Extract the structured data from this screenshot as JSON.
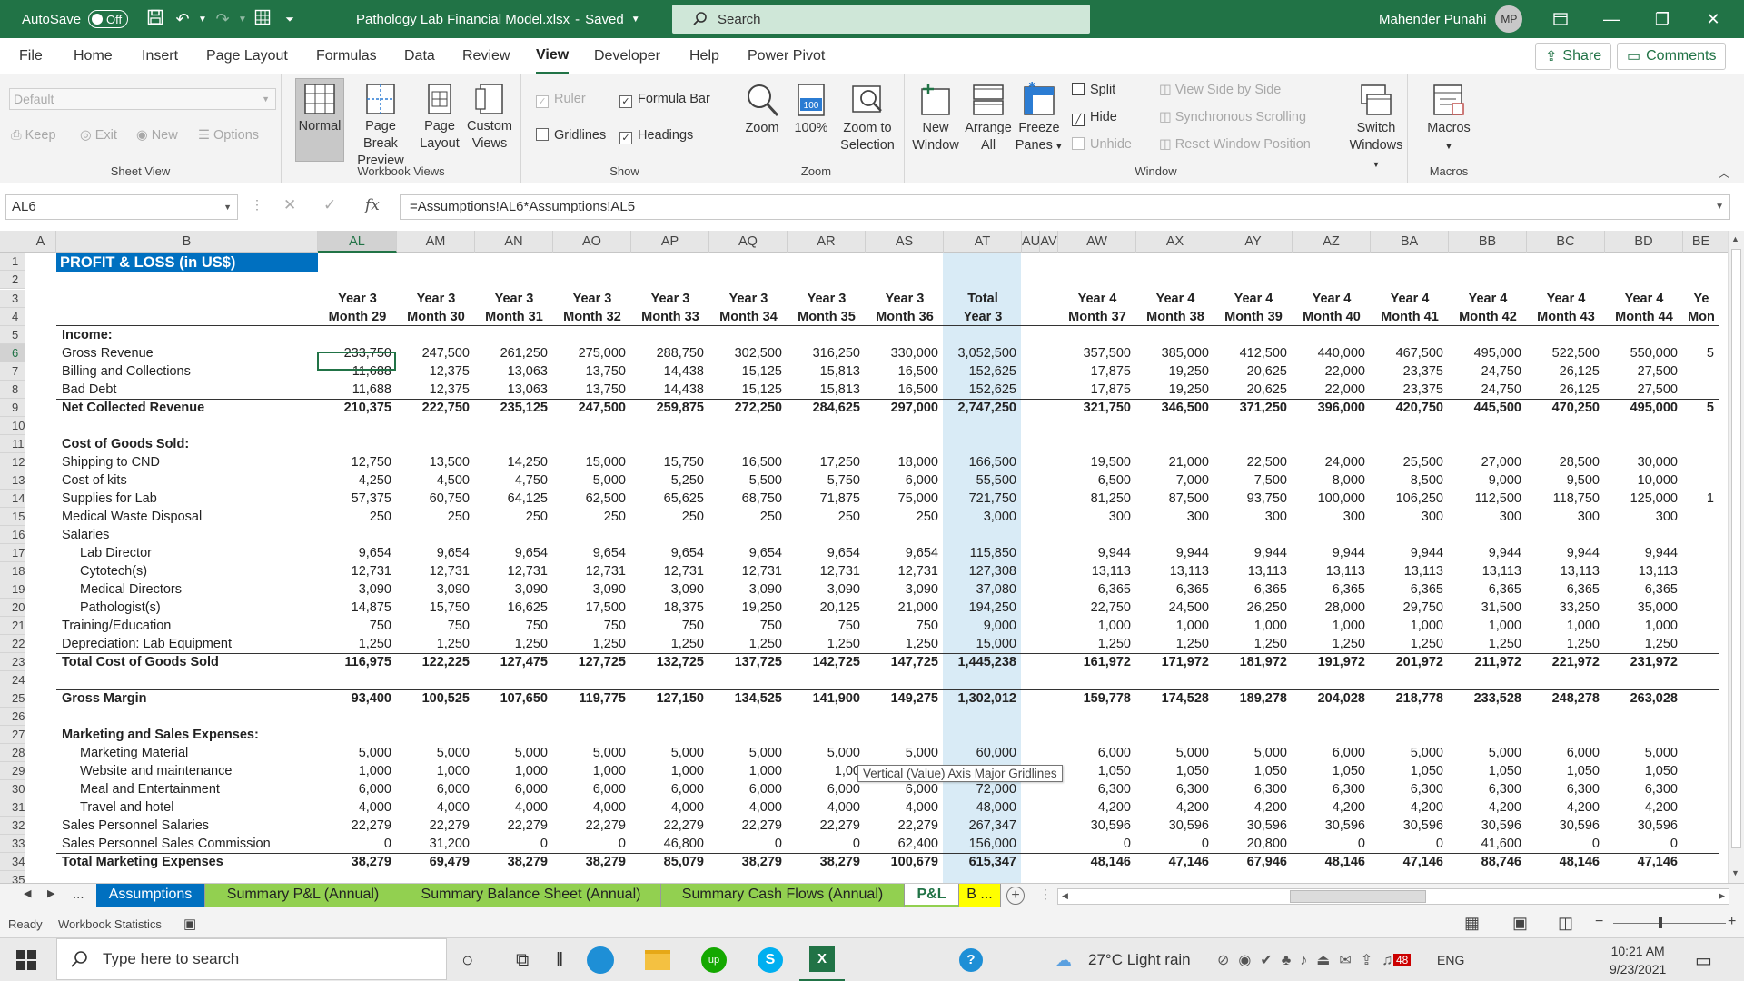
{
  "titlebar": {
    "autosave_label": "AutoSave",
    "autosave_state": "Off",
    "filename": "Pathology Lab Financial Model.xlsx",
    "saved": "Saved",
    "search_placeholder": "Search",
    "user": "Mahender Punahi",
    "initials": "MP"
  },
  "menu": {
    "items": [
      "File",
      "Home",
      "Insert",
      "Page Layout",
      "Formulas",
      "Data",
      "Review",
      "View",
      "Developer",
      "Help",
      "Power Pivot"
    ],
    "active": "View",
    "share": "Share",
    "comments": "Comments"
  },
  "ribbon": {
    "sheet_view": {
      "name": "Sheet View",
      "dropdown": "Default",
      "keep": "Keep",
      "exit": "Exit",
      "new": "New",
      "options": "Options"
    },
    "workbook_views": {
      "name": "Workbook Views",
      "normal": "Normal",
      "page_break_1": "Page Break",
      "page_break_2": "Preview",
      "page_layout_1": "Page",
      "page_layout_2": "Layout",
      "custom_1": "Custom",
      "custom_2": "Views"
    },
    "show": {
      "name": "Show",
      "ruler": "Ruler",
      "formula_bar": "Formula Bar",
      "gridlines": "Gridlines",
      "headings": "Headings"
    },
    "zoom": {
      "name": "Zoom",
      "zoom": "Zoom",
      "hundred": "100%",
      "icon_100": "100",
      "zoom_sel_1": "Zoom to",
      "zoom_sel_2": "Selection"
    },
    "window": {
      "name": "Window",
      "new_1": "New",
      "new_2": "Window",
      "arrange_1": "Arrange",
      "arrange_2": "All",
      "freeze_1": "Freeze",
      "freeze_2": "Panes",
      "split": "Split",
      "hide": "Hide",
      "unhide": "Unhide",
      "side_by_side": "View Side by Side",
      "sync_scroll": "Synchronous Scrolling",
      "reset_pos": "Reset Window Position",
      "switch_1": "Switch",
      "switch_2": "Windows"
    },
    "macros": {
      "name": "Macros",
      "macros": "Macros"
    }
  },
  "formula": {
    "namebox": "AL6",
    "cancel": "✕",
    "enter": "✓",
    "fx": "fx",
    "text": "=Assumptions!AL6*Assumptions!AL5"
  },
  "columns": [
    "A",
    "B",
    "AL",
    "AM",
    "AN",
    "AO",
    "AP",
    "AQ",
    "AR",
    "AS",
    "AT",
    "AU",
    "AV",
    "AW",
    "AX",
    "AY",
    "AZ",
    "BA",
    "BB",
    "BC",
    "BD",
    "BE"
  ],
  "sheet": {
    "title": "PROFIT & LOSS (in US$)",
    "header_year": [
      "Year 3",
      "Year 3",
      "Year 3",
      "Year 3",
      "Year 3",
      "Year 3",
      "Year 3",
      "Year 3",
      "Total",
      "Year 4",
      "Year 4",
      "Year 4",
      "Year 4",
      "Year 4",
      "Year 4",
      "Year 4",
      "Year 4",
      "Ye"
    ],
    "header_month": [
      "Month 29",
      "Month 30",
      "Month 31",
      "Month 32",
      "Month 33",
      "Month 34",
      "Month 35",
      "Month 36",
      "Year 3",
      "Month 37",
      "Month 38",
      "Month 39",
      "Month 40",
      "Month 41",
      "Month 42",
      "Month 43",
      "Month 44",
      "Mon"
    ],
    "rows": [
      {
        "r": 1,
        "label": ""
      },
      {
        "r": 2,
        "label": ""
      },
      {
        "r": 3,
        "label": ""
      },
      {
        "r": 4,
        "label": ""
      },
      {
        "r": 5,
        "label": "Income:",
        "bold": true
      },
      {
        "r": 6,
        "label": "Gross Revenue",
        "v": [
          "233,750",
          "247,500",
          "261,250",
          "275,000",
          "288,750",
          "302,500",
          "316,250",
          "330,000",
          "3,052,500",
          "357,500",
          "385,000",
          "412,500",
          "440,000",
          "467,500",
          "495,000",
          "522,500",
          "550,000",
          "5"
        ]
      },
      {
        "r": 7,
        "label": "Billing and Collections",
        "v": [
          "11,688",
          "12,375",
          "13,063",
          "13,750",
          "14,438",
          "15,125",
          "15,813",
          "16,500",
          "152,625",
          "17,875",
          "19,250",
          "20,625",
          "22,000",
          "23,375",
          "24,750",
          "26,125",
          "27,500",
          ""
        ]
      },
      {
        "r": 8,
        "label": "Bad Debt",
        "v": [
          "11,688",
          "12,375",
          "13,063",
          "13,750",
          "14,438",
          "15,125",
          "15,813",
          "16,500",
          "152,625",
          "17,875",
          "19,250",
          "20,625",
          "22,000",
          "23,375",
          "24,750",
          "26,125",
          "27,500",
          ""
        ]
      },
      {
        "r": 9,
        "label": "Net Collected Revenue",
        "bold": true,
        "v": [
          "210,375",
          "222,750",
          "235,125",
          "247,500",
          "259,875",
          "272,250",
          "284,625",
          "297,000",
          "2,747,250",
          "321,750",
          "346,500",
          "371,250",
          "396,000",
          "420,750",
          "445,500",
          "470,250",
          "495,000",
          "5"
        ]
      },
      {
        "r": 10,
        "label": ""
      },
      {
        "r": 11,
        "label": "Cost of Goods Sold:",
        "bold": true
      },
      {
        "r": 12,
        "label": "Shipping to CND",
        "v": [
          "12,750",
          "13,500",
          "14,250",
          "15,000",
          "15,750",
          "16,500",
          "17,250",
          "18,000",
          "166,500",
          "19,500",
          "21,000",
          "22,500",
          "24,000",
          "25,500",
          "27,000",
          "28,500",
          "30,000",
          ""
        ]
      },
      {
        "r": 13,
        "label": "Cost of kits",
        "v": [
          "4,250",
          "4,500",
          "4,750",
          "5,000",
          "5,250",
          "5,500",
          "5,750",
          "6,000",
          "55,500",
          "6,500",
          "7,000",
          "7,500",
          "8,000",
          "8,500",
          "9,000",
          "9,500",
          "10,000",
          ""
        ]
      },
      {
        "r": 14,
        "label": "Supplies for Lab",
        "v": [
          "57,375",
          "60,750",
          "64,125",
          "62,500",
          "65,625",
          "68,750",
          "71,875",
          "75,000",
          "721,750",
          "81,250",
          "87,500",
          "93,750",
          "100,000",
          "106,250",
          "112,500",
          "118,750",
          "125,000",
          "1"
        ]
      },
      {
        "r": 15,
        "label": "Medical Waste Disposal",
        "v": [
          "250",
          "250",
          "250",
          "250",
          "250",
          "250",
          "250",
          "250",
          "3,000",
          "300",
          "300",
          "300",
          "300",
          "300",
          "300",
          "300",
          "300",
          ""
        ]
      },
      {
        "r": 16,
        "label": "Salaries"
      },
      {
        "r": 17,
        "label": "Lab Director",
        "indent": true,
        "v": [
          "9,654",
          "9,654",
          "9,654",
          "9,654",
          "9,654",
          "9,654",
          "9,654",
          "9,654",
          "115,850",
          "9,944",
          "9,944",
          "9,944",
          "9,944",
          "9,944",
          "9,944",
          "9,944",
          "9,944",
          ""
        ]
      },
      {
        "r": 18,
        "label": "Cytotech(s)",
        "indent": true,
        "v": [
          "12,731",
          "12,731",
          "12,731",
          "12,731",
          "12,731",
          "12,731",
          "12,731",
          "12,731",
          "127,308",
          "13,113",
          "13,113",
          "13,113",
          "13,113",
          "13,113",
          "13,113",
          "13,113",
          "13,113",
          ""
        ]
      },
      {
        "r": 19,
        "label": "Medical Directors",
        "indent": true,
        "v": [
          "3,090",
          "3,090",
          "3,090",
          "3,090",
          "3,090",
          "3,090",
          "3,090",
          "3,090",
          "37,080",
          "6,365",
          "6,365",
          "6,365",
          "6,365",
          "6,365",
          "6,365",
          "6,365",
          "6,365",
          ""
        ]
      },
      {
        "r": 20,
        "label": "Pathologist(s)",
        "indent": true,
        "v": [
          "14,875",
          "15,750",
          "16,625",
          "17,500",
          "18,375",
          "19,250",
          "20,125",
          "21,000",
          "194,250",
          "22,750",
          "24,500",
          "26,250",
          "28,000",
          "29,750",
          "31,500",
          "33,250",
          "35,000",
          ""
        ]
      },
      {
        "r": 21,
        "label": "Training/Education",
        "v": [
          "750",
          "750",
          "750",
          "750",
          "750",
          "750",
          "750",
          "750",
          "9,000",
          "1,000",
          "1,000",
          "1,000",
          "1,000",
          "1,000",
          "1,000",
          "1,000",
          "1,000",
          ""
        ]
      },
      {
        "r": 22,
        "label": "Depreciation: Lab Equipment",
        "v": [
          "1,250",
          "1,250",
          "1,250",
          "1,250",
          "1,250",
          "1,250",
          "1,250",
          "1,250",
          "15,000",
          "1,250",
          "1,250",
          "1,250",
          "1,250",
          "1,250",
          "1,250",
          "1,250",
          "1,250",
          ""
        ]
      },
      {
        "r": 23,
        "label": "Total Cost of Goods Sold",
        "bold": true,
        "v": [
          "116,975",
          "122,225",
          "127,475",
          "127,725",
          "132,725",
          "137,725",
          "142,725",
          "147,725",
          "1,445,238",
          "161,972",
          "171,972",
          "181,972",
          "191,972",
          "201,972",
          "211,972",
          "221,972",
          "231,972",
          ""
        ]
      },
      {
        "r": 24,
        "label": ""
      },
      {
        "r": 25,
        "label": "Gross Margin",
        "bold": true,
        "v": [
          "93,400",
          "100,525",
          "107,650",
          "119,775",
          "127,150",
          "134,525",
          "141,900",
          "149,275",
          "1,302,012",
          "159,778",
          "174,528",
          "189,278",
          "204,028",
          "218,778",
          "233,528",
          "248,278",
          "263,028",
          ""
        ]
      },
      {
        "r": 26,
        "label": ""
      },
      {
        "r": 27,
        "label": "Marketing and Sales Expenses:",
        "bold": true
      },
      {
        "r": 28,
        "label": "Marketing Material",
        "indent": true,
        "v": [
          "5,000",
          "5,000",
          "5,000",
          "5,000",
          "5,000",
          "5,000",
          "5,000",
          "5,000",
          "60,000",
          "6,000",
          "5,000",
          "5,000",
          "6,000",
          "5,000",
          "5,000",
          "6,000",
          "5,000",
          ""
        ]
      },
      {
        "r": 29,
        "label": "Website and maintenance",
        "indent": true,
        "v": [
          "1,000",
          "1,000",
          "1,000",
          "1,000",
          "1,000",
          "1,000",
          "1,00",
          "",
          "",
          "1,050",
          "1,050",
          "1,050",
          "1,050",
          "1,050",
          "1,050",
          "1,050",
          "1,050",
          ""
        ]
      },
      {
        "r": 30,
        "label": "Meal and Entertainment",
        "indent": true,
        "v": [
          "6,000",
          "6,000",
          "6,000",
          "6,000",
          "6,000",
          "6,000",
          "6,000",
          "6,000",
          "72,000",
          "6,300",
          "6,300",
          "6,300",
          "6,300",
          "6,300",
          "6,300",
          "6,300",
          "6,300",
          ""
        ]
      },
      {
        "r": 31,
        "label": "Travel and hotel",
        "indent": true,
        "v": [
          "4,000",
          "4,000",
          "4,000",
          "4,000",
          "4,000",
          "4,000",
          "4,000",
          "4,000",
          "48,000",
          "4,200",
          "4,200",
          "4,200",
          "4,200",
          "4,200",
          "4,200",
          "4,200",
          "4,200",
          ""
        ]
      },
      {
        "r": 32,
        "label": "Sales Personnel Salaries",
        "v": [
          "22,279",
          "22,279",
          "22,279",
          "22,279",
          "22,279",
          "22,279",
          "22,279",
          "22,279",
          "267,347",
          "30,596",
          "30,596",
          "30,596",
          "30,596",
          "30,596",
          "30,596",
          "30,596",
          "30,596",
          ""
        ]
      },
      {
        "r": 33,
        "label": "Sales Personnel Sales Commission",
        "v": [
          "0",
          "31,200",
          "0",
          "0",
          "46,800",
          "0",
          "0",
          "62,400",
          "156,000",
          "0",
          "0",
          "20,800",
          "0",
          "0",
          "41,600",
          "0",
          "0",
          ""
        ]
      },
      {
        "r": 34,
        "label": "Total Marketing Expenses",
        "bold": true,
        "v": [
          "38,279",
          "69,479",
          "38,279",
          "38,279",
          "85,079",
          "38,279",
          "38,279",
          "100,679",
          "615,347",
          "48,146",
          "47,146",
          "67,946",
          "48,146",
          "47,146",
          "88,746",
          "48,146",
          "47,146",
          ""
        ]
      },
      {
        "r": 35,
        "label": ""
      }
    ]
  },
  "tooltip": "Vertical (Value) Axis Major Gridlines",
  "tabs": [
    "Assumptions",
    "Summary P&L (Annual)",
    "Summary Balance Sheet (Annual)",
    "Summary Cash Flows (Annual)",
    "P&L",
    "B ..."
  ],
  "tabs_more": "...",
  "status": {
    "ready": "Ready",
    "stats": "Workbook Statistics"
  },
  "taskbar": {
    "search": "Type here to search",
    "weather": "27°C  Light rain",
    "lang": "ENG",
    "time": "10:21 AM",
    "date": "9/23/2021",
    "badge": "48"
  },
  "colors": {
    "excel_green": "#217346",
    "tab_green": "#92d050",
    "tab_blue": "#0070c0",
    "title_blue": "#0070c0",
    "highlight": "#d9ebf6",
    "tab_yellow": "#ffff00"
  }
}
